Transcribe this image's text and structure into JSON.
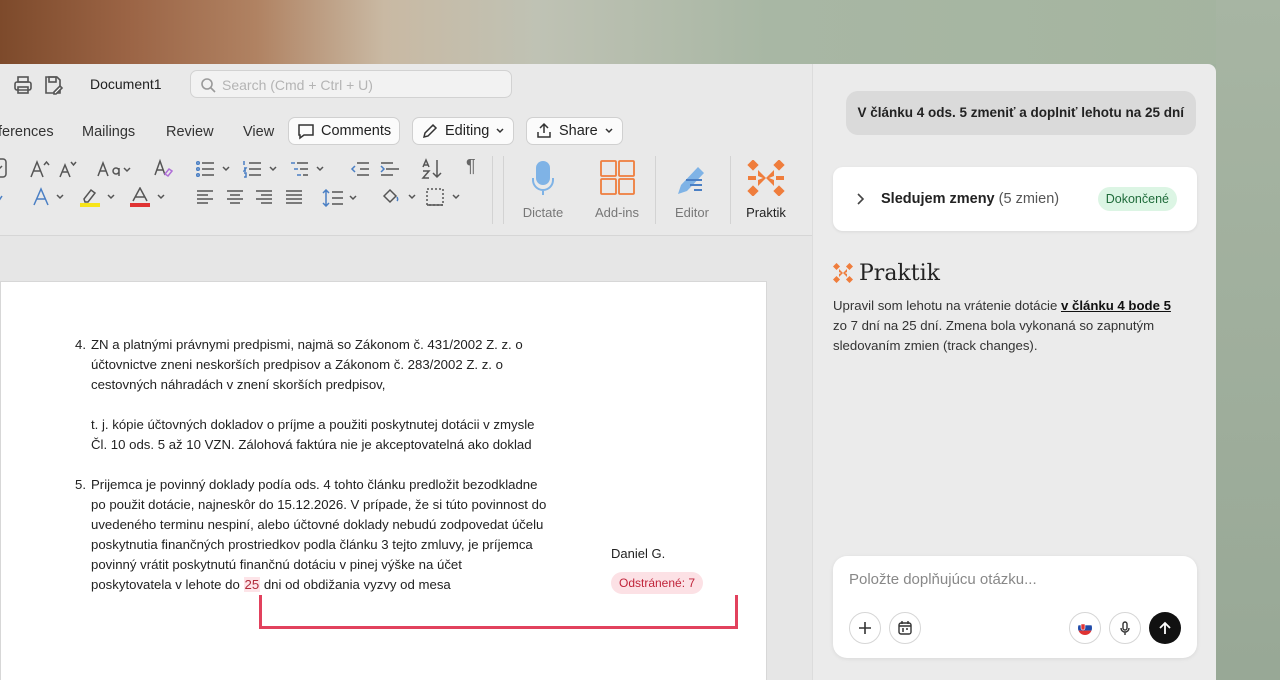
{
  "word": {
    "doc_name": "Document1",
    "search_placeholder": "Search (Cmd + Ctrl + U)",
    "tabs": [
      "ferences",
      "Mailings",
      "Review",
      "View"
    ],
    "pills": {
      "comments": "Comments",
      "editing": "Editing",
      "share": "Share"
    },
    "ribbon": {
      "dictate": "Dictate",
      "addins": "Add-ins",
      "editor": "Editor",
      "praktik": "Praktik"
    }
  },
  "document": {
    "item4_num": "4.",
    "item4_lines": [
      "ZN a platnými právnymi predpismi, najmä so Zákonom č. 431/2002 Z. z. o",
      "účtovnictve zneni neskorších predpisov a Zákonom č. 283/2002 Z. z. o",
      "cestovných náhradách v znení skorších predpisov,"
    ],
    "item4b_lines": [
      "t. j. kópie účtovných dokladov o príjme a použiti poskytnutej dotácii v zmysle",
      "Čl. 10 ods. 5 až 10 VZN. Zálohová faktúra nie je akceptovatelná ako doklad"
    ],
    "item5_num": "5.",
    "item5_lines": [
      "Prijemca je povinný doklady podía ods. 4 tohto článku predložit bezodkladne",
      "po použit dotácie, najneskôr do 15.12.2026. V prípade, že si túto povinnost do",
      "uvedeného terminu nespiní, alebo účtovné doklady nebudú zodpovedat účelu",
      "poskytnutia finančných prostriedkov podla článku 3 tejto zmluvy, je príjemca",
      "povinný vrátit poskytnutú finančnú dotáciu v pinej výške na účet"
    ],
    "last_line_pre": "poskytovatela v lehote do ",
    "last_line_highlight": "25",
    "last_line_post": " dni od obdižania vyzvy od mesa",
    "track_author": "Daniel G.",
    "track_badge": "Odstránené: 7"
  },
  "panel": {
    "user_message": "V článku 4 ods. 5 zmeniť a doplniť lehotu na 25 dní",
    "status_title": "Sledujem zmeny",
    "status_count": "(5 zmien)",
    "status_badge": "Dokončené",
    "brand": "Praktik",
    "answer_pre": "Upravil som lehotu na vrátenie dotácie ",
    "answer_link": "v článku 4 bode 5",
    "answer_post": " zo 7 dní na 25 dní. Zmena bola vykonaná so zapnutým sledovaním zmien (track changes).",
    "composer_placeholder": "Položte doplňujúcu otázku..."
  },
  "colors": {
    "accent_orange": "#ef7d3c",
    "track_red": "#e2415d",
    "done_green": "#1f6b3a"
  }
}
